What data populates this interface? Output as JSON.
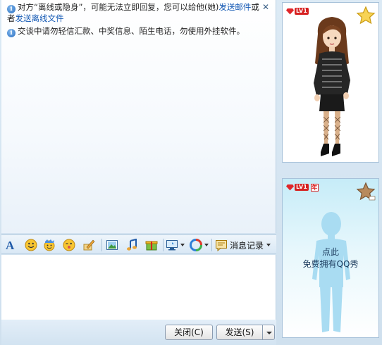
{
  "notices": {
    "offline_prefix": "对方“离线或隐身”，可能无法立即回复，您可以给他(她)",
    "offline_link_mail": "发送邮件",
    "offline_middle": "或者",
    "offline_link_file": "发送离线文件",
    "safety": "交谈中请勿轻信汇款、中奖信息、陌生电话，勿使用外挂软件。"
  },
  "toolbar": {
    "icons": [
      "font-icon",
      "emoticon-icon",
      "magic-emoticon-icon",
      "wink-icon",
      "scribble-icon",
      "image-icon",
      "music-icon",
      "gift-icon",
      "screenshot-icon",
      "qq-show-icon"
    ],
    "history_label": "消息记录"
  },
  "buttons": {
    "close": "关闭(C)",
    "send": "发送(S)"
  },
  "my_show": {
    "level": "LV1"
  },
  "peer_show": {
    "level": "LV1",
    "year_badge": "年",
    "cta_line1": "点此",
    "cta_line2": "免费拥有QQ秀"
  },
  "colors": {
    "link": "#1358b4",
    "level_badge": "#d62020",
    "panel_border": "#a8c2da"
  }
}
